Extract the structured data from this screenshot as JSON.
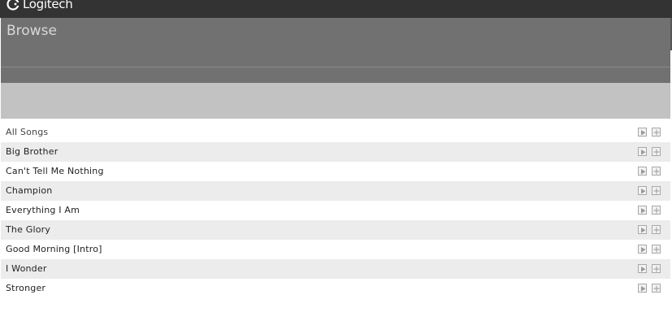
{
  "brand": {
    "name": "Logitech"
  },
  "browse": {
    "title": "Browse"
  },
  "songs": [
    {
      "label": "All Songs"
    },
    {
      "label": "Big Brother"
    },
    {
      "label": "Can't Tell Me Nothing"
    },
    {
      "label": "Champion"
    },
    {
      "label": "Everything I Am"
    },
    {
      "label": "The Glory"
    },
    {
      "label": "Good Morning [Intro]"
    },
    {
      "label": "I Wonder"
    },
    {
      "label": "Stronger"
    }
  ],
  "icons": {
    "play": "play-icon",
    "add": "plus-icon"
  },
  "colors": {
    "topbar": "#333333",
    "panel": "#717171",
    "band": "#c2c2c2",
    "row_alt": "#ececec"
  }
}
